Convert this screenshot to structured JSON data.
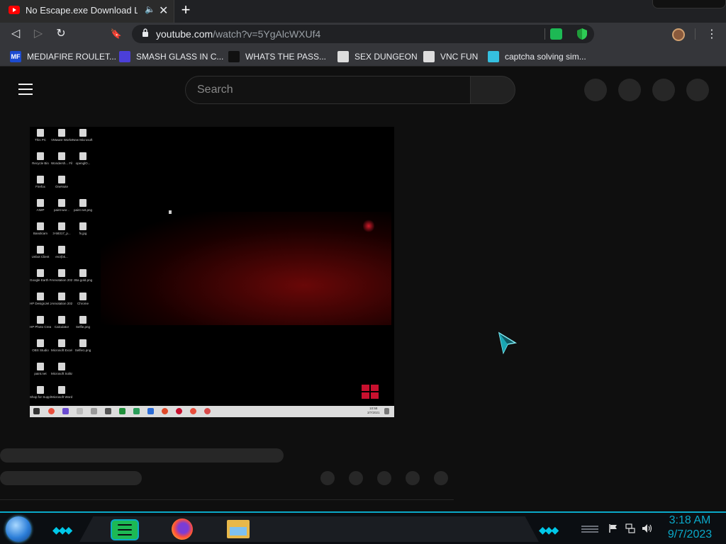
{
  "browser": {
    "tab": {
      "title": "No Escape.exe Download Link",
      "close_glyph": "✕",
      "audio_glyph": "🔈"
    },
    "new_tab_glyph": "+",
    "nav": {
      "back": "◁",
      "forward": "▷",
      "reload": "↻",
      "bookmark": "🔖",
      "menu": "⋮"
    },
    "url": {
      "host": "youtube.com",
      "path": "/watch?v=5YgAlcWXUf4"
    },
    "bookmarks": [
      {
        "label": "MEDIAFIRE ROULET...",
        "icon": "mediafire-icon",
        "icon_text": "MF",
        "color": "#1c4bd1"
      },
      {
        "label": "SMASH GLASS IN C...",
        "icon": "smash-glass-icon",
        "icon_text": "",
        "color": "#4b3fd8"
      },
      {
        "label": "WHATS THE PASS...",
        "icon": "password-site-icon",
        "icon_text": "",
        "color": "#111111"
      },
      {
        "label": "SEX DUNGEON",
        "icon": "ghost-icon",
        "icon_text": "",
        "color": "#dddddd"
      },
      {
        "label": "VNC FUN",
        "icon": "ghost-icon",
        "icon_text": "",
        "color": "#dddddd"
      },
      {
        "label": "captcha solving sim...",
        "icon": "captcha-icon",
        "icon_text": "",
        "color": "#35c0e0"
      }
    ]
  },
  "youtube": {
    "search": {
      "placeholder": "Search"
    },
    "video": {
      "desktop_icons": [
        [
          "This PC",
          "VMware Workstati...",
          "New Microsoft ..."
        ],
        [
          "Recycle Bin",
          "Wondersh... Filmora9",
          "openglO..."
        ],
        [
          "Firefox",
          "OneNote",
          ""
        ],
        [
          "AIMP",
          "paint-wor...",
          "paint net.png"
        ],
        [
          "Bandicam",
          "3-58317_p...",
          "fs.jpg"
        ],
        [
          "Unbot Client",
          "en3(bk...",
          ""
        ],
        [
          "Google Earth Pro",
          "Annotation 2021-10...",
          "zBa gold.png"
        ],
        [
          "HP DesignJet 2130 series",
          "Annotation 2021-10...",
          "Chrome"
        ],
        [
          "HP Photo Creations",
          "Calculator",
          "Selfie.png"
        ],
        [
          "OBS Studio",
          "Microsoft Excel",
          "Selfie1.png"
        ],
        [
          "paint.net",
          "Microsoft Solitaire...",
          ""
        ],
        [
          "Shop for Supplies ...",
          "Microsoft Word",
          ""
        ]
      ],
      "clock_time": "10:58",
      "clock_date": "3/7/2021"
    }
  },
  "taskbar": {
    "time": "3:18 AM",
    "date": "9/7/2023",
    "accent": "#0aa9c9"
  }
}
